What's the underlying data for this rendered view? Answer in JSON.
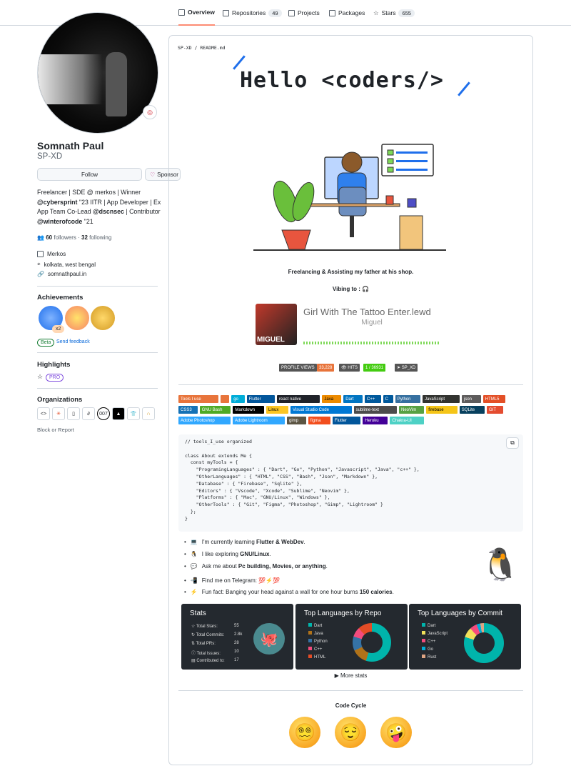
{
  "tabs": [
    {
      "label": "Overview",
      "count": ""
    },
    {
      "label": "Repositories",
      "count": "49"
    },
    {
      "label": "Projects",
      "count": ""
    },
    {
      "label": "Packages",
      "count": ""
    },
    {
      "label": "Stars",
      "count": "655"
    }
  ],
  "profile": {
    "name": "Somnath Paul",
    "login": "SP-XD",
    "follow": "Follow",
    "sponsor": "Sponsor",
    "bio": {
      "p1": "Freelancer | SDE @ merkos | Winner ",
      "h1": "@cybersprint",
      "p2": " \"23 IITR | App Developer | Ex App Team Co-Lead ",
      "h2": "@dscnsec",
      "p3": " | Contributor ",
      "h3": "@winterofcode",
      "p4": " \"21"
    },
    "followers": "60",
    "followers_label": "followers",
    "following": "32",
    "following_label": "following",
    "company": "Merkos",
    "location": "kolkata, west bengal",
    "website": "somnathpaul.in"
  },
  "achievements": {
    "title": "Achievements",
    "x2": "x2",
    "beta": "Beta",
    "feedback": "Send feedback"
  },
  "highlights": {
    "title": "Highlights",
    "pro": "PRO"
  },
  "organizations": {
    "title": "Organizations",
    "block": "Block or Report"
  },
  "readme": {
    "path_user": "SP-XD",
    "path_file": "README.md",
    "hello": "Hello <coders/>",
    "tagline": "Freelancing & Assisting my father at his shop.",
    "vibing": "Vibing to : 🎧",
    "song": "Girl With The Tattoo Enter.lewd",
    "artist": "Miguel",
    "cover_text": "MIGUEL",
    "views_label": "PROFILE VIEWS",
    "views": "33,228",
    "hits_label": "HITS",
    "hits": "1 / 36931",
    "sp_label": "SP_XD",
    "tools": [
      {
        "l": "Tools I use",
        "c": "#e8743b"
      },
      {
        "l": "",
        "c": "#e8743b"
      },
      {
        "l": "go",
        "c": "#00add8"
      },
      {
        "l": "Flutter",
        "c": "#02569b"
      },
      {
        "l": "react native",
        "c": "#20232a"
      },
      {
        "l": "Java",
        "c": "#ed8b00"
      },
      {
        "l": "Dart",
        "c": "#0175c2"
      },
      {
        "l": "C++",
        "c": "#00599c"
      },
      {
        "l": "C",
        "c": "#00599c"
      },
      {
        "l": "Python",
        "c": "#3670a0"
      },
      {
        "l": "JavaScript",
        "c": "#323330"
      },
      {
        "l": "json",
        "c": "#5e5c5c"
      },
      {
        "l": "HTML5",
        "c": "#e34f26"
      },
      {
        "l": "CSS3",
        "c": "#1572b6"
      },
      {
        "l": "GNU Bash",
        "c": "#4eaa25"
      },
      {
        "l": "Markdown",
        "c": "#000000"
      },
      {
        "l": "Linux",
        "c": "#fcc624"
      },
      {
        "l": "Visual Studio Code",
        "c": "#0078d4"
      },
      {
        "l": "sublime-text",
        "c": "#4c4c4c"
      },
      {
        "l": "NeoVim",
        "c": "#57a143"
      },
      {
        "l": "firebase",
        "c": "#f5c518"
      },
      {
        "l": "SQLite",
        "c": "#07405e"
      },
      {
        "l": "GIT",
        "c": "#e44c30"
      },
      {
        "l": "Adobe Photoshop",
        "c": "#31a8ff"
      },
      {
        "l": "Adobe Lightroom",
        "c": "#31a8ff"
      },
      {
        "l": "gimp",
        "c": "#5c5543"
      },
      {
        "l": "figma",
        "c": "#f24e1e"
      },
      {
        "l": "Flutter",
        "c": "#02569b"
      },
      {
        "l": "Heroku",
        "c": "#430098"
      },
      {
        "l": "Chakra-UI",
        "c": "#4ed1c5"
      }
    ],
    "code": "// tools_I_use organized\n\nclass About extends Me {\n  const myTools = {\n    \"ProgramingLanguages\" : { \"Dart\", \"Go\", \"Python\", \"Javascript\", \"Java\", \"c++\" },\n    \"OtherLanguages\" : { \"HTML\", \"CSS\", \"Bash\", \"Json\", \"Markdown\" },\n    \"Database\" : { \"Firebase\", \"Sqlite\" },\n    \"Editors\" : { \"Vscode\", \"Xcode\", \"Sublime\", \"Neovim\" },\n    \"Platforms\" : { \"Mac\", \"GNU/Linux\", \"Windows\" },\n    \"OtherTools\" : { \"Git\", \"Figma\", \"Photoshop\", \"Gimp\", \"Lightroom\" }\n  };\n}",
    "list": [
      {
        "pre": "I'm currently learning ",
        "b": "Flutter & WebDev",
        "post": "."
      },
      {
        "pre": "I like exploring ",
        "b": "GNU/Linux",
        "post": "."
      },
      {
        "pre": "Ask me about ",
        "b": "Pc building, Movies, or anything",
        "post": "."
      },
      {
        "pre": "Find me on Telegram: ",
        "b": "",
        "post": "💯⚡💯"
      },
      {
        "pre": "Fun fact: Banging your head against a wall for one hour burns ",
        "b": "150 calories",
        "post": "."
      }
    ],
    "stats": {
      "title": "Stats",
      "rows": [
        {
          "k": "Total Stars:",
          "v": "55"
        },
        {
          "k": "Total Commits:",
          "v": "2.8k"
        },
        {
          "k": "Total PRs:",
          "v": "28"
        },
        {
          "k": "Total Issues:",
          "v": "10"
        },
        {
          "k": "Contributed to:",
          "v": "17"
        }
      ]
    },
    "repo_langs": {
      "title": "Top Languages by Repo",
      "items": [
        {
          "n": "Dart",
          "c": "#00b4ab"
        },
        {
          "n": "Java",
          "c": "#b07219"
        },
        {
          "n": "Python",
          "c": "#3572a5"
        },
        {
          "n": "C++",
          "c": "#f34b7d"
        },
        {
          "n": "HTML",
          "c": "#e34c26"
        }
      ]
    },
    "commit_langs": {
      "title": "Top Languages by Commit",
      "items": [
        {
          "n": "Dart",
          "c": "#00b4ab"
        },
        {
          "n": "JavaScript",
          "c": "#f1e05a"
        },
        {
          "n": "C++",
          "c": "#f34b7d"
        },
        {
          "n": "Go",
          "c": "#00add8"
        },
        {
          "n": "Rust",
          "c": "#dea584"
        }
      ]
    },
    "more": "▶ More stats",
    "code_cycle": "Code Cycle",
    "emojis": [
      "😵‍💫",
      "😌",
      "🤪"
    ]
  }
}
